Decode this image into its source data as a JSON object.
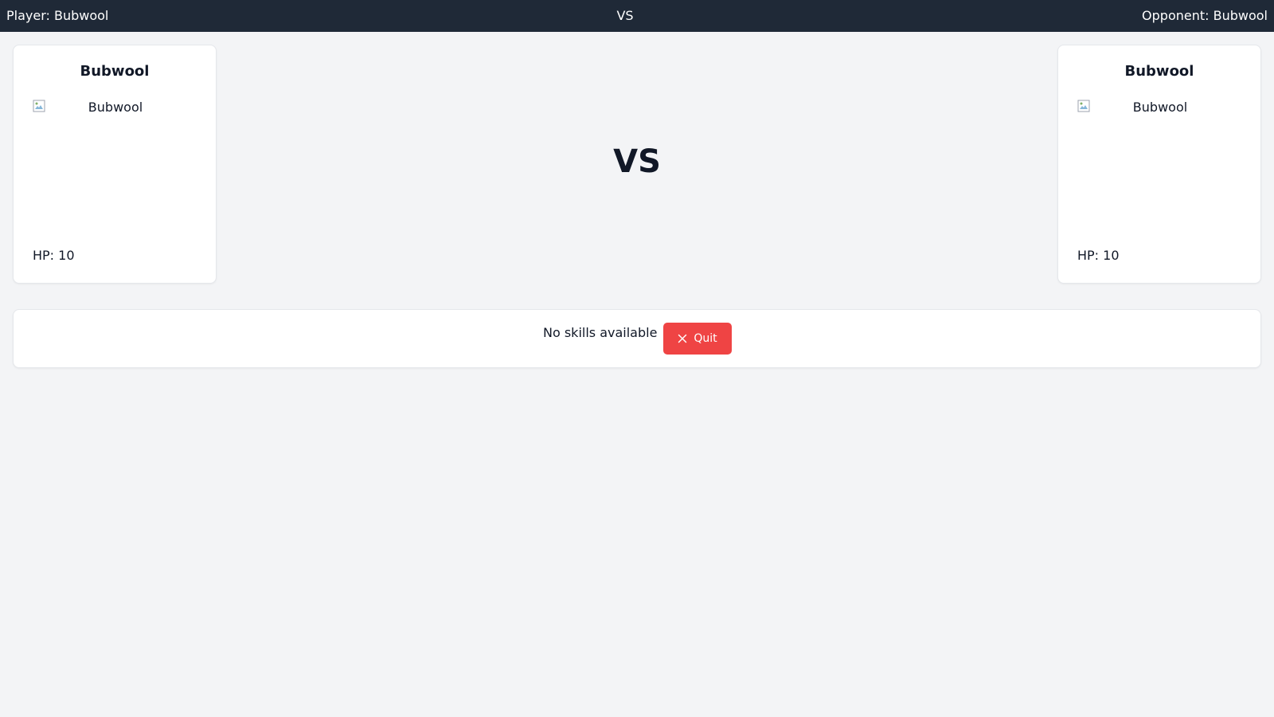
{
  "header": {
    "player_label": "Player: Bubwool",
    "vs_label": "VS",
    "opponent_label": "Opponent: Bubwool"
  },
  "player": {
    "name": "Bubwool",
    "image_alt": "Bubwool",
    "hp_text": "HP: 10"
  },
  "opponent": {
    "name": "Bubwool",
    "image_alt": "Bubwool",
    "hp_text": "HP: 10"
  },
  "center": {
    "vs_text": "VS"
  },
  "skills": {
    "empty_text": "No skills available",
    "quit_label": "Quit",
    "quit_icon": "close-icon"
  },
  "colors": {
    "header_bg": "#1f2937",
    "page_bg": "#f3f4f6",
    "quit_bg": "#ef4444"
  }
}
